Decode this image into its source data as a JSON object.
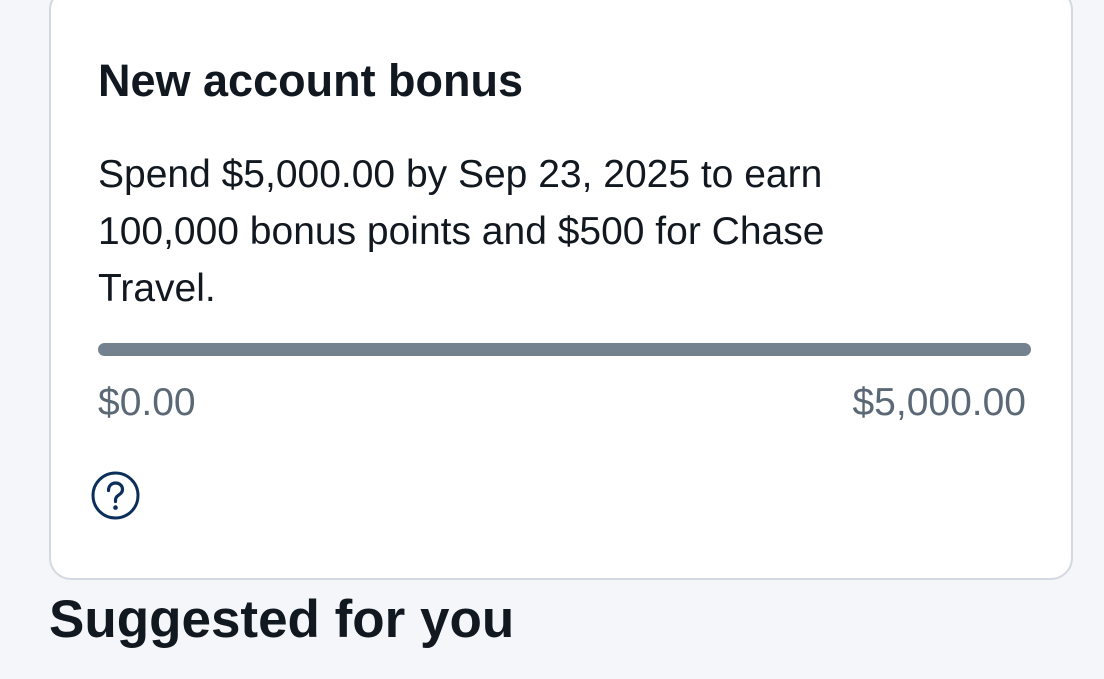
{
  "bonus_card": {
    "title": "New account bonus",
    "description": "Spend $5,000.00 by Sep 23, 2025 to earn 100,000 bonus points and $500 for Chase Travel.",
    "progress": {
      "fraction": 0,
      "start_label": "$0.00",
      "goal_label": "$5,000.00"
    },
    "help_icon": "question-circle-icon"
  },
  "suggested_section": {
    "title": "Suggested for you"
  },
  "colors": {
    "page_background": "#f4f6f9",
    "card_background": "#ffffff",
    "card_border": "#d3d9e0",
    "text_primary": "#111820",
    "text_secondary": "#5b6875",
    "progress_track": "#74818e",
    "icon_stroke": "#0b2f5a"
  }
}
